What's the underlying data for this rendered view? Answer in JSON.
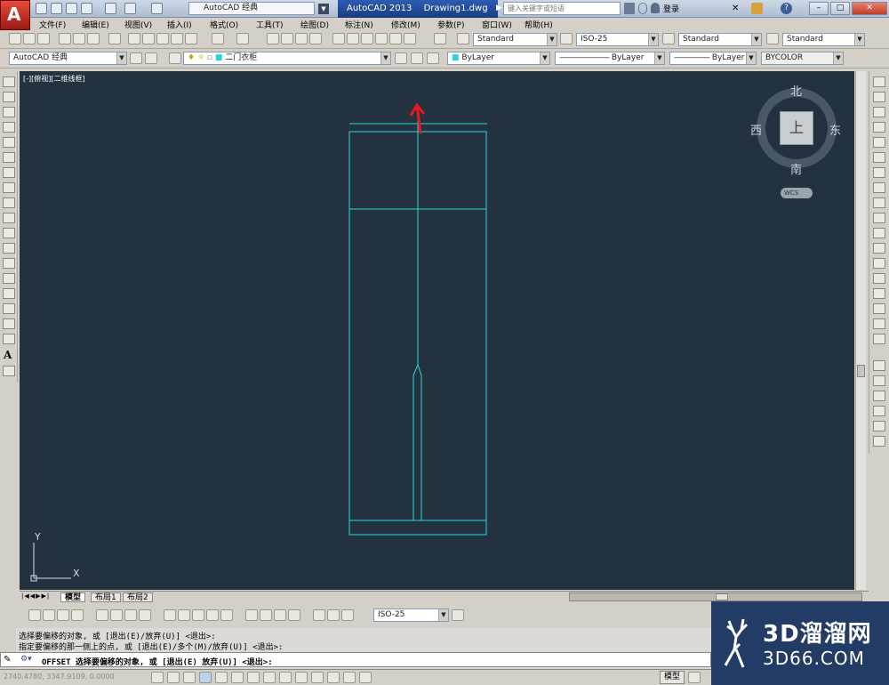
{
  "title_bar": {
    "workspace": "AutoCAD 经典",
    "app_name": "AutoCAD 2013",
    "document": "Drawing1.dwg",
    "search_placeholder": "键入关键字或短语",
    "login": "登录"
  },
  "menu": [
    "文件(F)",
    "编辑(E)",
    "视图(V)",
    "插入(I)",
    "格式(O)",
    "工具(T)",
    "绘图(D)",
    "标注(N)",
    "修改(M)",
    "参数(P)",
    "窗口(W)",
    "帮助(H)"
  ],
  "styles_toolbar": {
    "text_style": "Standard",
    "dim_style": "ISO-25",
    "table_style": "Standard",
    "multileader_style": "Standard"
  },
  "layers_toolbar": {
    "workspace": "AutoCAD 经典",
    "layer": "二门衣柜"
  },
  "properties_toolbar": {
    "color": "ByLayer",
    "linetype": "ByLayer",
    "lineweight": "ByLayer",
    "plot_style": "BYCOLOR"
  },
  "viewport": {
    "label": "[-][俯视][二维线框]",
    "compass": {
      "north": "北",
      "south": "南",
      "east": "东",
      "west": "西",
      "top": "上"
    },
    "wcs": "WCS",
    "ucs_x": "X",
    "ucs_y": "Y",
    "line_color": "#2ad4dc",
    "arrow_color": "#e8181e"
  },
  "layout_tabs": [
    "模型",
    "布局1",
    "布局2"
  ],
  "dim_toolbar": {
    "dim_style": "ISO-25"
  },
  "command": {
    "history_1": "选择要偏移的对象, 或 [退出(E)/放弃(U)] <退出>:",
    "history_2": "指定要偏移的那一侧上的点, 或 [退出(E)/多个(M)/放弃(U)] <退出>:",
    "current": "OFFSET 选择要偏移的对象, 或 [退出(E) 放弃(U)] <退出>:"
  },
  "status": {
    "coordinates": "2740.4780, 3347.9109, 0.0000",
    "model": "模型"
  },
  "watermark": {
    "name": "3D溜溜网",
    "url": "3D66.COM"
  }
}
